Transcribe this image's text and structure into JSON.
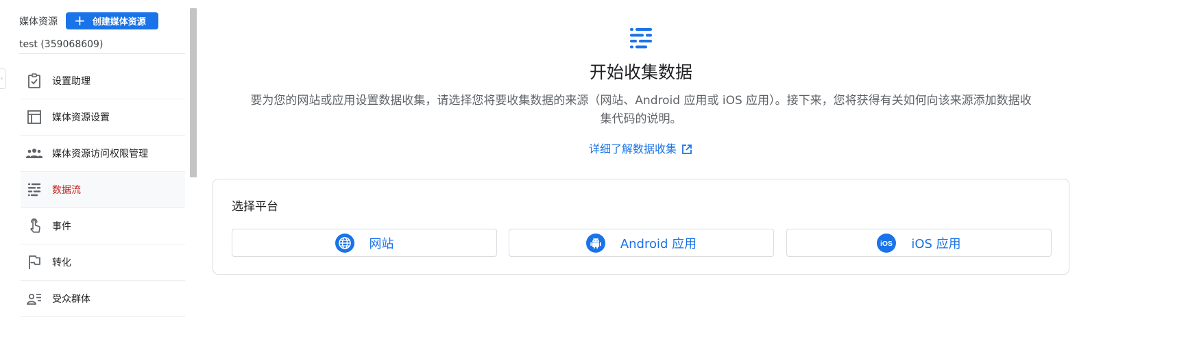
{
  "sidebar": {
    "header_label": "媒体资源",
    "create_button": {
      "icon": "plus-icon",
      "label": "创建媒体资源"
    },
    "account": "test (359068609)",
    "items": [
      {
        "icon": "clipboard-check-icon",
        "label": "设置助理",
        "active": false
      },
      {
        "icon": "layout-icon",
        "label": "媒体资源设置",
        "active": false
      },
      {
        "icon": "people-icon",
        "label": "媒体资源访问权限管理",
        "active": false
      },
      {
        "icon": "data-streams-icon",
        "label": "数据流",
        "active": true
      },
      {
        "icon": "touch-icon",
        "label": "事件",
        "active": false
      },
      {
        "icon": "flag-icon",
        "label": "转化",
        "active": false
      },
      {
        "icon": "audience-icon",
        "label": "受众群体",
        "active": false
      }
    ]
  },
  "main": {
    "icon": "data-streams-icon",
    "title": "开始收集数据",
    "description": "要为您的网站或应用设置数据收集，请选择您将要收集数据的来源（网站、Android 应用或 iOS 应用）。接下来，您将获得有关如何向该来源添加数据收集代码的说明。",
    "learn_more": {
      "label": "详细了解数据收集",
      "icon": "open-in-new-icon"
    },
    "platform": {
      "title": "选择平台",
      "options": [
        {
          "icon": "globe-icon",
          "label": "网站"
        },
        {
          "icon": "android-icon",
          "label": "Android 应用"
        },
        {
          "icon": "ios-icon",
          "label": "iOS 应用",
          "icon_text": "iOS"
        }
      ]
    }
  },
  "colors": {
    "accent": "#1a73e8",
    "active_nav": "#c5221f",
    "icon_gray": "#5f6368",
    "border": "#dadce0"
  }
}
